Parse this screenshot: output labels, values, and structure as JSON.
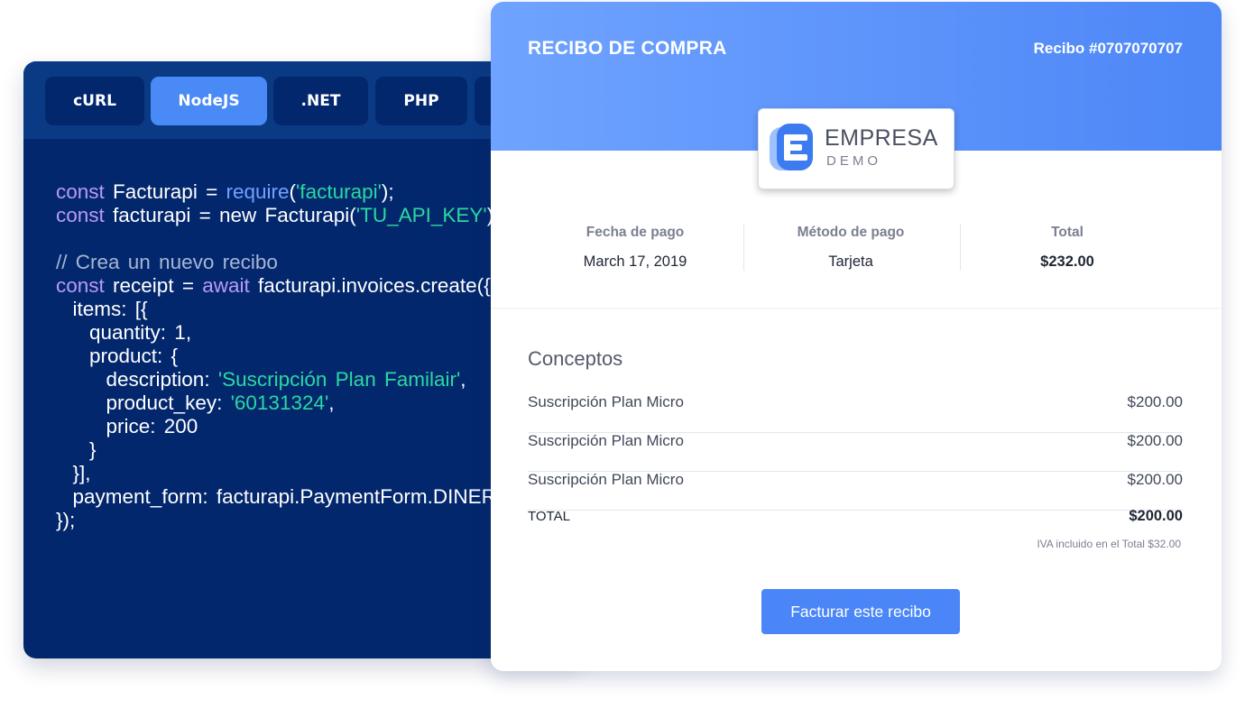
{
  "code_panel": {
    "tabs": [
      {
        "label": "cURL",
        "active": false
      },
      {
        "label": "NodeJS",
        "active": true
      },
      {
        "label": ".NET",
        "active": false
      },
      {
        "label": "PHP",
        "active": false
      }
    ],
    "code_lines": [
      [
        {
          "t": "const",
          "c": "kw"
        },
        {
          "t": " Facturapi = "
        },
        {
          "t": "require",
          "c": "fn"
        },
        {
          "t": "("
        },
        {
          "t": "'facturapi'",
          "c": "str"
        },
        {
          "t": ");"
        }
      ],
      [
        {
          "t": "const",
          "c": "kw"
        },
        {
          "t": " facturapi = new Facturapi("
        },
        {
          "t": "'TU_API_KEY'",
          "c": "str"
        },
        {
          "t": ");"
        }
      ],
      [],
      [
        {
          "t": "// Crea un nuevo recibo",
          "c": "cm"
        }
      ],
      [
        {
          "t": "const",
          "c": "kw"
        },
        {
          "t": " receipt = "
        },
        {
          "t": "await",
          "c": "kw"
        },
        {
          "t": " facturapi.invoices.create({"
        }
      ],
      [
        {
          "t": "  items: [{"
        }
      ],
      [
        {
          "t": "    quantity: 1,"
        }
      ],
      [
        {
          "t": "    product: {"
        }
      ],
      [
        {
          "t": "      description: "
        },
        {
          "t": "'Suscripción Plan Familair'",
          "c": "str"
        },
        {
          "t": ","
        }
      ],
      [
        {
          "t": "      product_key: "
        },
        {
          "t": "'60131324'",
          "c": "str"
        },
        {
          "t": ","
        }
      ],
      [
        {
          "t": "      price: 200"
        }
      ],
      [
        {
          "t": "    }"
        }
      ],
      [
        {
          "t": "  }],"
        }
      ],
      [
        {
          "t": "  payment_form: facturapi.PaymentForm.DINERO"
        }
      ],
      [
        {
          "t": "});"
        }
      ]
    ]
  },
  "receipt": {
    "title": "RECIBO DE COMPRA",
    "number": "Recibo #0707070707",
    "logo": {
      "name": "EMPRESA",
      "sub": "DEMO",
      "icon": "empresa-e-logo-icon"
    },
    "summary": {
      "date_label": "Fecha de pago",
      "date_value": "March 17, 2019",
      "method_label": "Método de pago",
      "method_value": "Tarjeta",
      "total_label": "Total",
      "total_value": "$232.00"
    },
    "concepts_title": "Conceptos",
    "items": [
      {
        "name": "Suscripción Plan Micro",
        "price": "$200.00"
      },
      {
        "name": "Suscripción Plan Micro",
        "price": "$200.00"
      },
      {
        "name": "Suscripción Plan Micro",
        "price": "$200.00"
      }
    ],
    "total_label": "TOTAL",
    "total_value": "$200.00",
    "iva_note": "IVA incluido en el Total $32.00",
    "invoice_button": "Facturar este recibo"
  },
  "colors": {
    "code_bg": "#03276d",
    "tab_bar": "#0b3a85",
    "tab_active": "#4a8af6",
    "header_gradient_start": "#6fa3ff",
    "header_gradient_end": "#4d87f7",
    "button": "#4a86f7"
  }
}
